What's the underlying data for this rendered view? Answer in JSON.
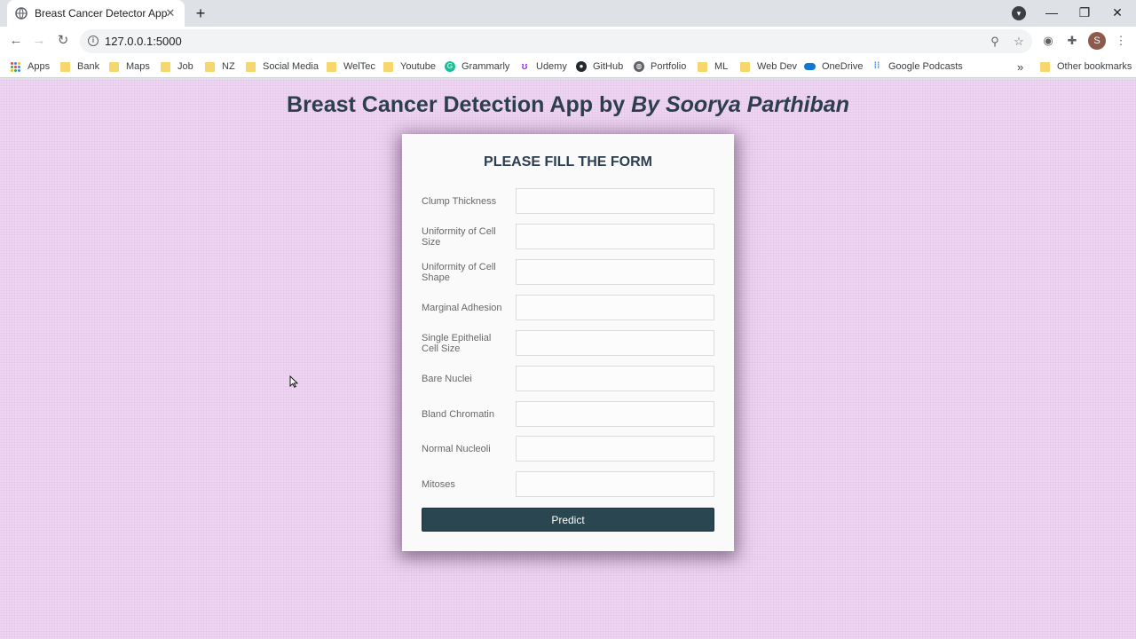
{
  "browser": {
    "tab_title": "Breast Cancer Detector App",
    "tab_close": "✕",
    "new_tab": "+",
    "url": "127.0.0.1:5000",
    "avatar_initial": "S",
    "win_minimize": "—",
    "win_restore": "❐",
    "win_close": "✕"
  },
  "bookmarks": {
    "items": [
      {
        "label": "Apps",
        "icon": "apps-grid-icon"
      },
      {
        "label": "Bank",
        "icon": "folder-icon"
      },
      {
        "label": "Maps",
        "icon": "folder-icon"
      },
      {
        "label": "Job",
        "icon": "folder-icon"
      },
      {
        "label": "NZ",
        "icon": "folder-icon"
      },
      {
        "label": "Social Media",
        "icon": "folder-icon"
      },
      {
        "label": "WelTec",
        "icon": "folder-icon"
      },
      {
        "label": "Youtube",
        "icon": "folder-icon"
      },
      {
        "label": "Grammarly",
        "icon": "grammarly-icon"
      },
      {
        "label": "Udemy",
        "icon": "udemy-icon"
      },
      {
        "label": "GitHub",
        "icon": "github-icon"
      },
      {
        "label": "Portfolio",
        "icon": "globe-icon"
      },
      {
        "label": "ML",
        "icon": "folder-icon"
      },
      {
        "label": "Web Dev",
        "icon": "folder-icon"
      },
      {
        "label": "OneDrive",
        "icon": "onedrive-icon"
      },
      {
        "label": "Google Podcasts",
        "icon": "podcasts-icon"
      }
    ],
    "overflow": "»",
    "other_bookmarks": "Other bookmarks"
  },
  "page": {
    "title_prefix": "Breast Cancer Detection App by ",
    "title_author": "By Soorya Parthiban",
    "form_heading": "PLEASE FILL THE FORM",
    "fields": [
      {
        "label": "Clump Thickness",
        "value": ""
      },
      {
        "label": "Uniformity of Cell Size",
        "value": ""
      },
      {
        "label": "Uniformity of Cell Shape",
        "value": ""
      },
      {
        "label": "Marginal Adhesion",
        "value": ""
      },
      {
        "label": "Single Epithelial Cell Size",
        "value": ""
      },
      {
        "label": "Bare Nuclei",
        "value": ""
      },
      {
        "label": "Bland Chromatin",
        "value": ""
      },
      {
        "label": "Normal Nucleoli",
        "value": ""
      },
      {
        "label": "Mitoses",
        "value": ""
      }
    ],
    "submit_label": "Predict"
  },
  "colors": {
    "page_bg": "#eed5f1",
    "heading": "#2d3e50",
    "button_bg": "#2a4650"
  }
}
